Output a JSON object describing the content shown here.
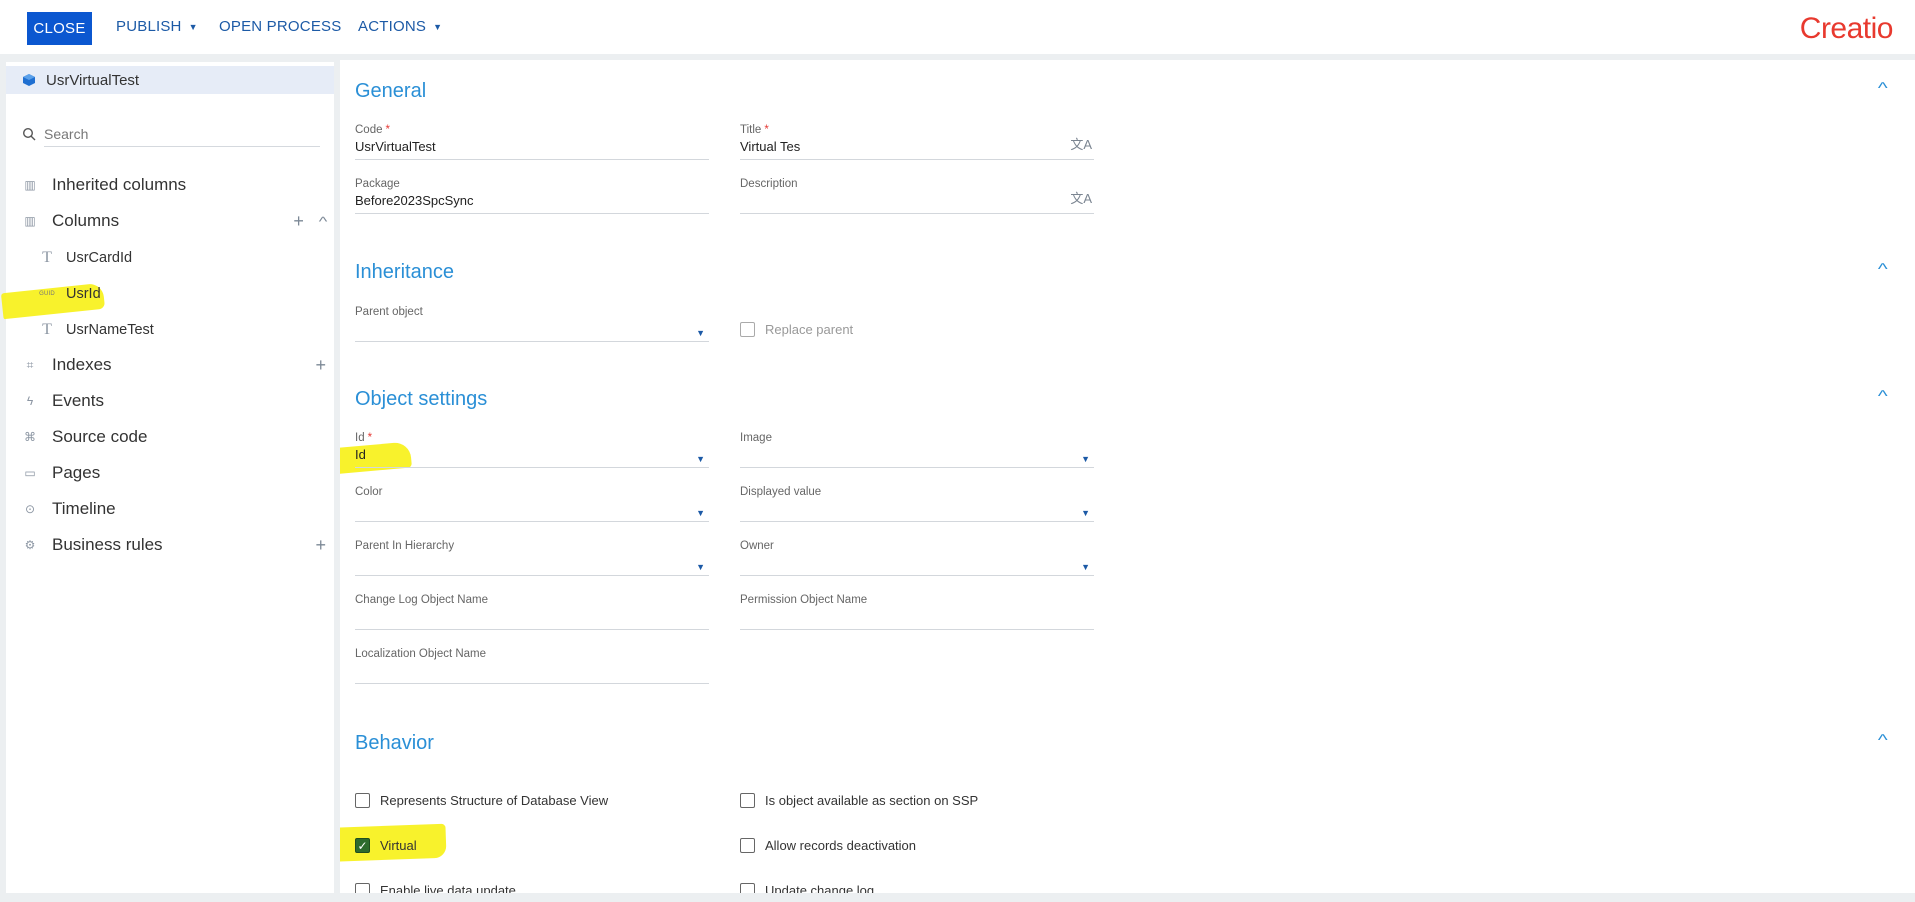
{
  "toolbar": {
    "close_label": "CLOSE",
    "publish_label": "PUBLISH",
    "open_process_label": "OPEN PROCESS",
    "actions_label": "ACTIONS",
    "logo_text": "Creatio"
  },
  "sidebar": {
    "object_name": "UsrVirtualTest",
    "search_placeholder": "Search",
    "items": [
      {
        "label": "Inherited columns",
        "icon": "columns-icon"
      },
      {
        "label": "Columns",
        "icon": "columns-icon"
      },
      {
        "label": "Indexes",
        "icon": "index-icon"
      },
      {
        "label": "Events",
        "icon": "lightning-icon"
      },
      {
        "label": "Source code",
        "icon": "code-icon"
      },
      {
        "label": "Pages",
        "icon": "window-icon"
      },
      {
        "label": "Timeline",
        "icon": "timeline-icon"
      },
      {
        "label": "Business rules",
        "icon": "rules-icon"
      }
    ],
    "columns": [
      {
        "label": "UsrCardId",
        "type": "text"
      },
      {
        "label": "UsrId",
        "type": "guid",
        "type_label": "GUID"
      },
      {
        "label": "UsrNameTest",
        "type": "text"
      }
    ]
  },
  "general": {
    "title": "General",
    "code_label": "Code",
    "code_value": "UsrVirtualTest",
    "title_label": "Title",
    "title_value": "Virtual Tes",
    "package_label": "Package",
    "package_value": "Before2023SpcSync",
    "description_label": "Description",
    "description_value": ""
  },
  "inheritance": {
    "title": "Inheritance",
    "parent_label": "Parent object",
    "parent_value": "",
    "replace_parent_label": "Replace parent"
  },
  "object_settings": {
    "title": "Object settings",
    "id_label": "Id",
    "id_value": "Id",
    "image_label": "Image",
    "color_label": "Color",
    "displayed_value_label": "Displayed value",
    "parent_hierarchy_label": "Parent In Hierarchy",
    "owner_label": "Owner",
    "change_log_label": "Change Log Object Name",
    "permission_label": "Permission Object Name",
    "localization_label": "Localization Object Name"
  },
  "behavior": {
    "title": "Behavior",
    "checkboxes": [
      {
        "label": "Represents Structure of Database View",
        "checked": false
      },
      {
        "label": "Is object available as section on SSP",
        "checked": false
      },
      {
        "label": "Virtual",
        "checked": true
      },
      {
        "label": "Allow records deactivation",
        "checked": false
      },
      {
        "label": "Enable live data update",
        "checked": false
      },
      {
        "label": "Update change log",
        "checked": false
      }
    ]
  },
  "colors": {
    "primary": "#0b57d0",
    "accent": "#2a8fd6",
    "highlight": "#f7f11a",
    "logo": "#e8392e"
  }
}
